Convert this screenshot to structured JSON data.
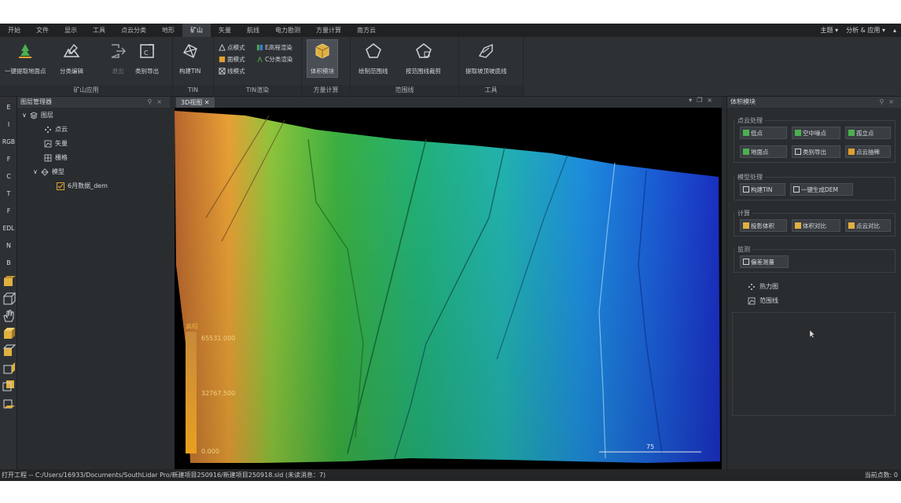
{
  "menu": {
    "items": [
      "开始",
      "文件",
      "显示",
      "工具",
      "点云分类",
      "地形",
      "矿山",
      "矢量",
      "航线",
      "电力勘测",
      "方量计算",
      "南方云"
    ],
    "active_index": 6,
    "theme": "主题 ▾",
    "analysis": "分析 & 应用 ▾",
    "collapse": "▴"
  },
  "ribbon": {
    "groups": [
      {
        "label": "矿山应用",
        "buttons": [
          "一键提取地面点",
          "分类编辑",
          "退出",
          "类别导出"
        ]
      },
      {
        "label": "TIN",
        "buttons": [
          "构建TIN"
        ]
      },
      {
        "label": "TIN渲染",
        "small": [
          "点模式",
          "面模式",
          "线模式",
          "E高程渲染",
          "C分类渲染"
        ]
      },
      {
        "label": "方量计算",
        "buttons": [
          "体积模块"
        ]
      },
      {
        "label": "范围线",
        "buttons": [
          "绘制范围线",
          "按范围线裁剪"
        ]
      },
      {
        "label": "工具",
        "buttons": [
          "提取坡顶坡底线"
        ]
      }
    ]
  },
  "left_toolbar": [
    "E",
    "I",
    "RGB",
    "F",
    "C",
    "T",
    "F",
    "EDL",
    "N",
    "B"
  ],
  "layer_manager": {
    "title": "图层管理器",
    "root": "图层",
    "items": [
      "点云",
      "矢量",
      "栅格",
      "模型"
    ],
    "model_child": "6月数据_dem"
  },
  "view": {
    "tab": "3D视图",
    "legend_title": "高程",
    "legend_top": "65531.000",
    "legend_mid": "32767.500",
    "legend_bottom": "0.000",
    "scale_label": "75"
  },
  "right_panel": {
    "title": "体积模块",
    "point_cloud": {
      "title": "点云处理",
      "buttons": [
        "低点",
        "空中噪点",
        "孤立点",
        "地面点",
        "类别导出",
        "点云抽稀"
      ]
    },
    "model": {
      "title": "模型处理",
      "buttons": [
        "构建TIN",
        "一键生成DEM"
      ]
    },
    "calc": {
      "title": "计算",
      "buttons": [
        "投影体积",
        "体积对比",
        "点云对比"
      ]
    },
    "monitor": {
      "title": "监测",
      "buttons": [
        "偏差测量"
      ]
    },
    "list": [
      "热力图",
      "范围线"
    ]
  },
  "status": {
    "path": "打开工程 -- C:/Users/16933/Documents/SouthLidar Pro/新建项目250916/新建项目250918.sld (未读消息：7)",
    "right": "当前点数: 0"
  },
  "colors": {
    "accent": "#3a7bd5",
    "ribbon_bg": "#2e3134",
    "panel_bg": "#2a2d30"
  }
}
